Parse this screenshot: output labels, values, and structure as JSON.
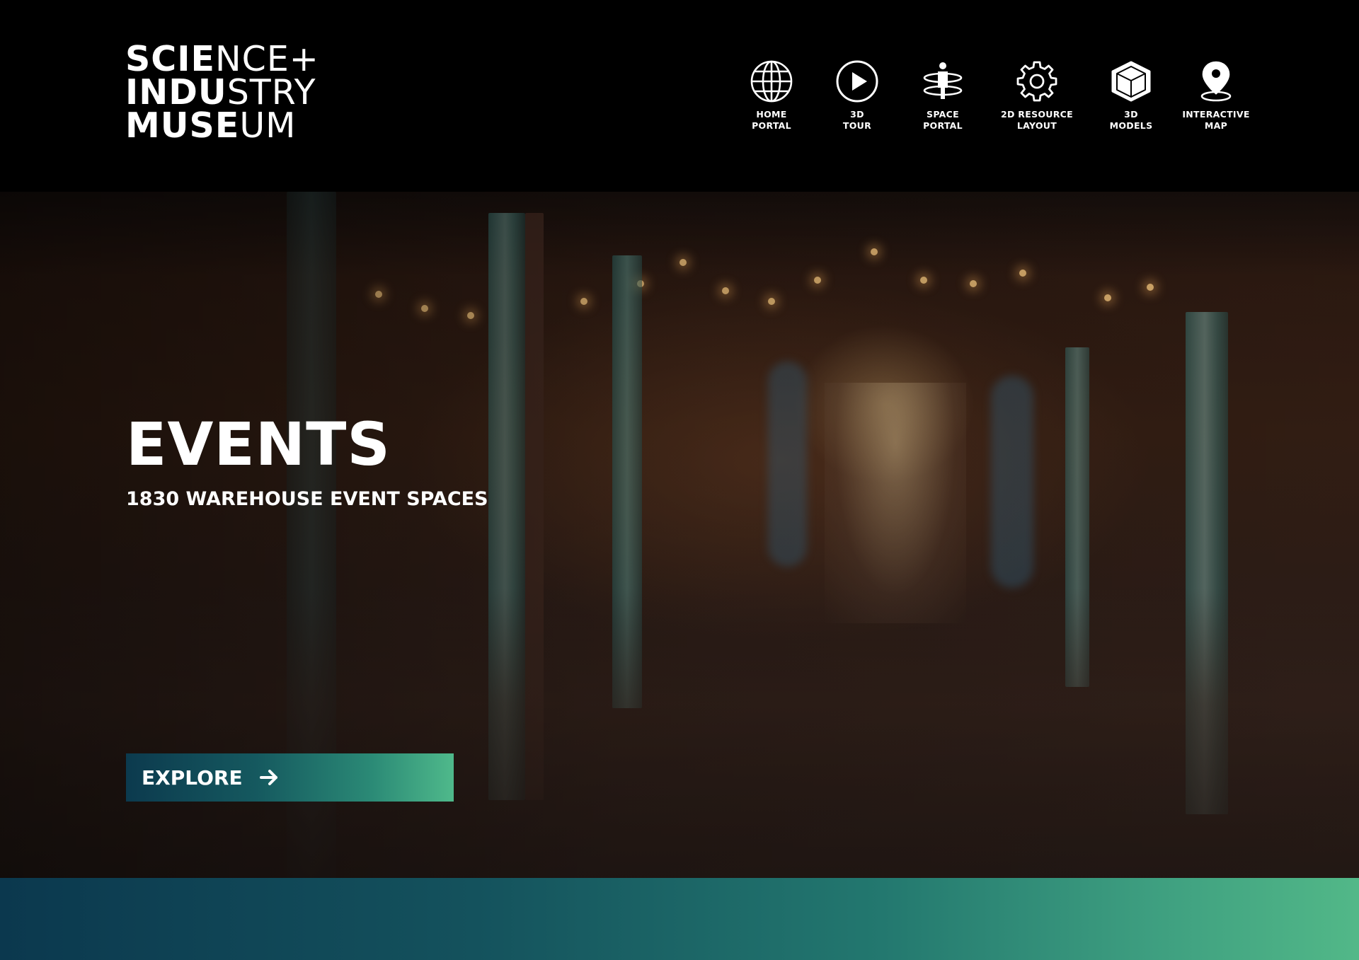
{
  "header": {
    "logo": {
      "line1_bold": "SCIE",
      "line1_thin": "NCE+",
      "line2_bold": "INDU",
      "line2_thin": "STRY",
      "line3_bold": "MUSE",
      "line3_thin": "UM"
    },
    "nav": [
      {
        "line1": "HOME",
        "line2": "PORTAL",
        "icon": "globe-icon"
      },
      {
        "line1": "3D",
        "line2": "TOUR",
        "icon": "play-icon"
      },
      {
        "line1": "SPACE",
        "line2": "PORTAL",
        "icon": "person-rings-icon"
      },
      {
        "line1": "2D RESOURCE",
        "line2": "LAYOUT",
        "icon": "gear-icon"
      },
      {
        "line1": "3D",
        "line2": "MODELS",
        "icon": "cube-icon"
      },
      {
        "line1": "INTERACTIVE",
        "line2": "MAP",
        "icon": "map-pin-icon"
      }
    ]
  },
  "hero": {
    "title": "EVENTS",
    "subtitle": "1830 WAREHOUSE EVENT SPACES",
    "explore_label": "EXPLORE",
    "explore_icon": "arrow-right-icon"
  },
  "colors": {
    "accent_start": "#0c3a4e",
    "accent_end": "#52b888",
    "header_bg": "#000000"
  }
}
